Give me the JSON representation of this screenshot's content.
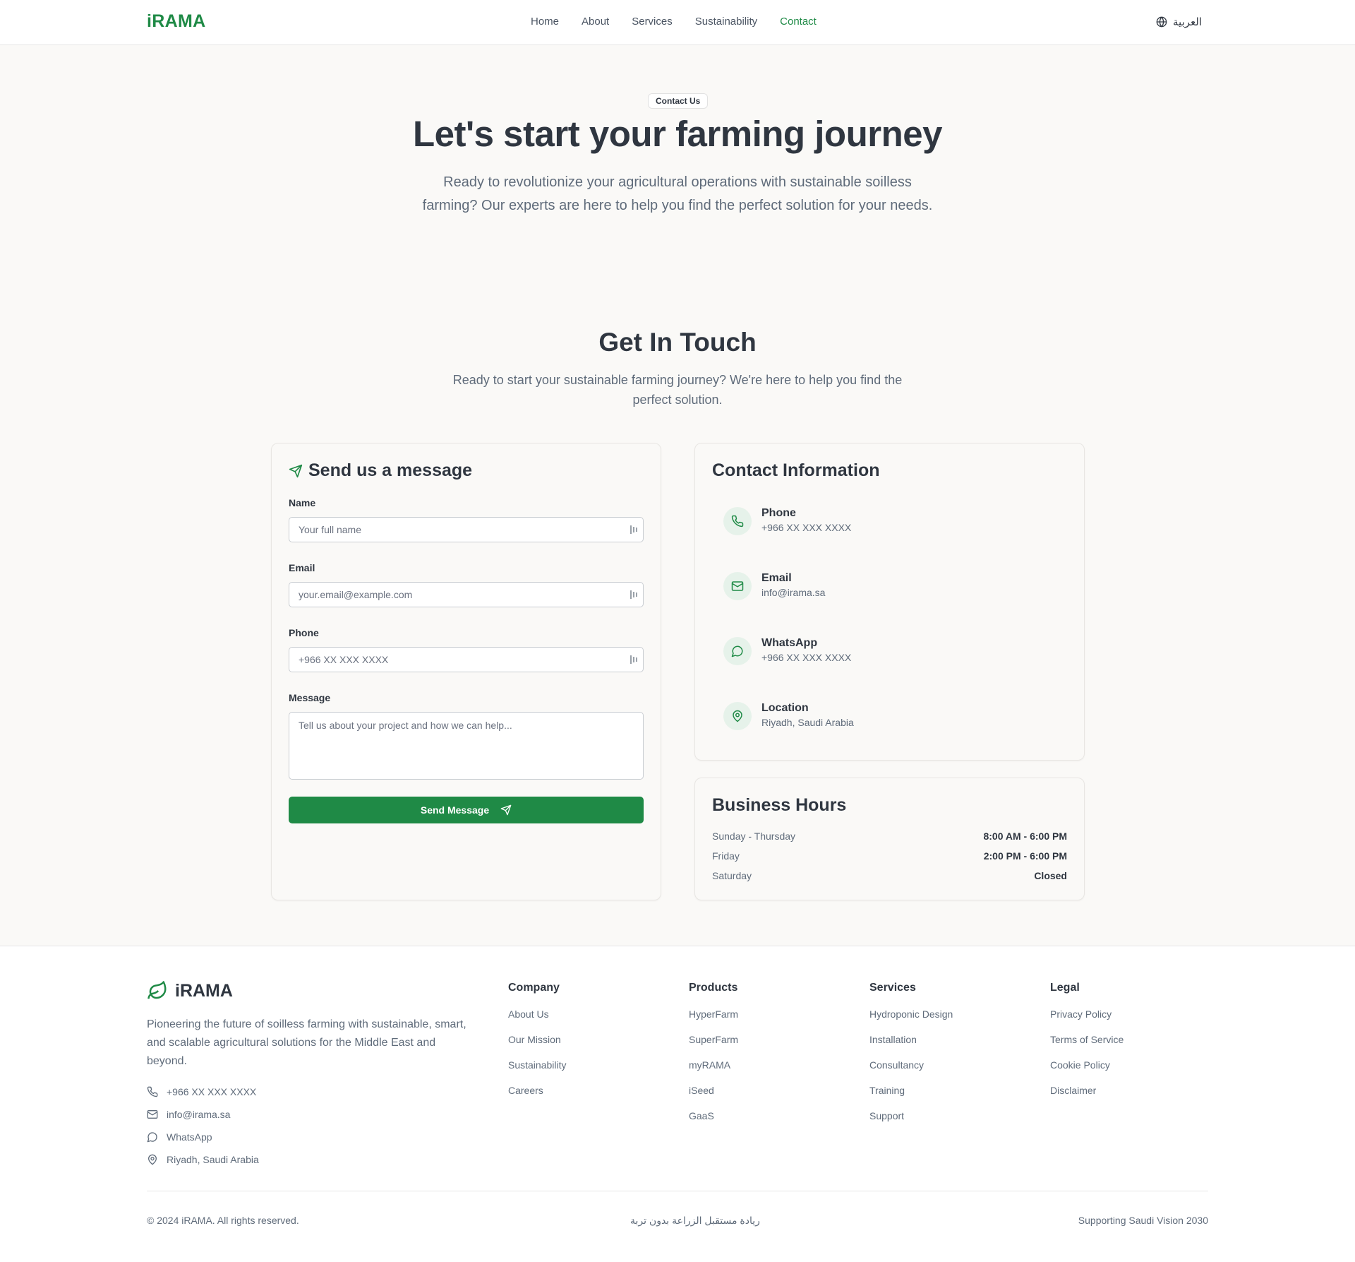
{
  "nav": {
    "logo": "iRAMA",
    "links": [
      "Home",
      "About",
      "Services",
      "Sustainability",
      "Contact"
    ],
    "language": "العربية"
  },
  "hero": {
    "badge": "Contact Us",
    "title": "Let's start your farming journey",
    "subtitle": "Ready to revolutionize your agricultural operations with sustainable soilless farming? Our experts are here to help you find the perfect solution for your needs."
  },
  "touch": {
    "title": "Get In Touch",
    "subtitle": "Ready to start your sustainable farming journey? We're here to help you find the perfect solution."
  },
  "form": {
    "title": "Send us a message",
    "name_label": "Name",
    "name_placeholder": "Your full name",
    "email_label": "Email",
    "email_placeholder": "your.email@example.com",
    "phone_label": "Phone",
    "phone_placeholder": "+966 XX XXX XXXX",
    "message_label": "Message",
    "message_placeholder": "Tell us about your project and how we can help...",
    "submit": "Send Message"
  },
  "contact_info": {
    "title": "Contact Information",
    "items": [
      {
        "label": "Phone",
        "value": "+966 XX XXX XXXX",
        "icon": "phone-icon"
      },
      {
        "label": "Email",
        "value": "info@irama.sa",
        "icon": "mail-icon"
      },
      {
        "label": "WhatsApp",
        "value": "+966 XX XXX XXXX",
        "icon": "message-icon"
      },
      {
        "label": "Location",
        "value": "Riyadh, Saudi Arabia",
        "icon": "map-pin-icon"
      }
    ]
  },
  "hours": {
    "title": "Business Hours",
    "rows": [
      {
        "day": "Sunday - Thursday",
        "time": "8:00 AM - 6:00 PM"
      },
      {
        "day": "Friday",
        "time": "2:00 PM - 6:00 PM"
      },
      {
        "day": "Saturday",
        "time": "Closed"
      }
    ]
  },
  "footer": {
    "brand": "iRAMA",
    "description": "Pioneering the future of soilless farming with sustainable, smart, and scalable agricultural solutions for the Middle East and beyond.",
    "contacts": [
      "+966 XX XXX XXXX",
      "info@irama.sa",
      "WhatsApp",
      "Riyadh, Saudi Arabia"
    ],
    "columns": [
      {
        "title": "Company",
        "links": [
          "About Us",
          "Our Mission",
          "Sustainability",
          "Careers"
        ]
      },
      {
        "title": "Products",
        "links": [
          "HyperFarm",
          "SuperFarm",
          "myRAMA",
          "iSeed",
          "GaaS"
        ]
      },
      {
        "title": "Services",
        "links": [
          "Hydroponic Design",
          "Installation",
          "Consultancy",
          "Training",
          "Support"
        ]
      },
      {
        "title": "Legal",
        "links": [
          "Privacy Policy",
          "Terms of Service",
          "Cookie Policy",
          "Disclaimer"
        ]
      }
    ],
    "copyright": "© 2024 iRAMA. All rights reserved.",
    "arabic_tagline": "ريادة مستقبل الزراعة بدون تربة",
    "vision": "Supporting Saudi Vision 2030"
  },
  "colors": {
    "brand_green": "#1f8a46",
    "icon_bg": "#e6f2ea",
    "text_dark": "#2f3640",
    "text_muted": "#5f6b7a",
    "page_bg": "#faf9f7"
  }
}
